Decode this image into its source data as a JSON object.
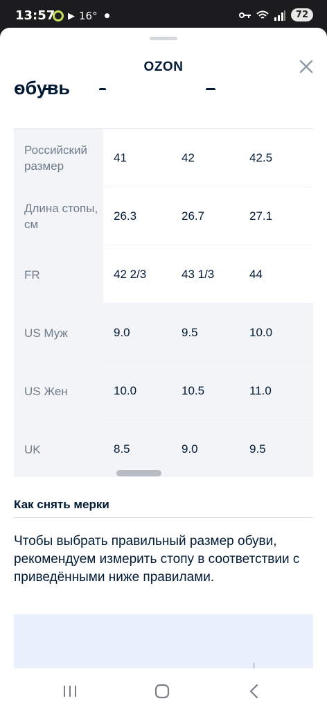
{
  "status_bar": {
    "time": "13:57",
    "temperature": "16°",
    "battery": "72",
    "icons": [
      "location-ring-icon",
      "play-icon",
      "key-icon",
      "wifi-icon",
      "signal-icon"
    ]
  },
  "sheet": {
    "title": "OZON",
    "partial_heading": "обувь",
    "table": {
      "rows": [
        {
          "label": "Российский размер",
          "values": [
            "41",
            "42",
            "42.5"
          ]
        },
        {
          "label": "Длина стопы, см",
          "values": [
            "26.3",
            "26.7",
            "27.1"
          ]
        },
        {
          "label": "FR",
          "values": [
            "42 2/3",
            "43 1/3",
            "44"
          ]
        },
        {
          "label": "US Муж",
          "values": [
            "9.0",
            "9.5",
            "10.0"
          ]
        },
        {
          "label": "US Жен",
          "values": [
            "10.0",
            "10.5",
            "11.0"
          ]
        },
        {
          "label": "UK",
          "values": [
            "8.5",
            "9.0",
            "9.5"
          ]
        }
      ]
    },
    "measure_section": {
      "title": "Как снять мерки",
      "text": "Чтобы выбрать правильный размер обуви, рекомендуем измерить стопу в соответствии с приведёнными ниже правилами."
    }
  },
  "colors": {
    "text_primary": "#001a34",
    "table_header_bg": "#f2f4f7",
    "image_placeholder_bg": "#eaf1fc"
  }
}
